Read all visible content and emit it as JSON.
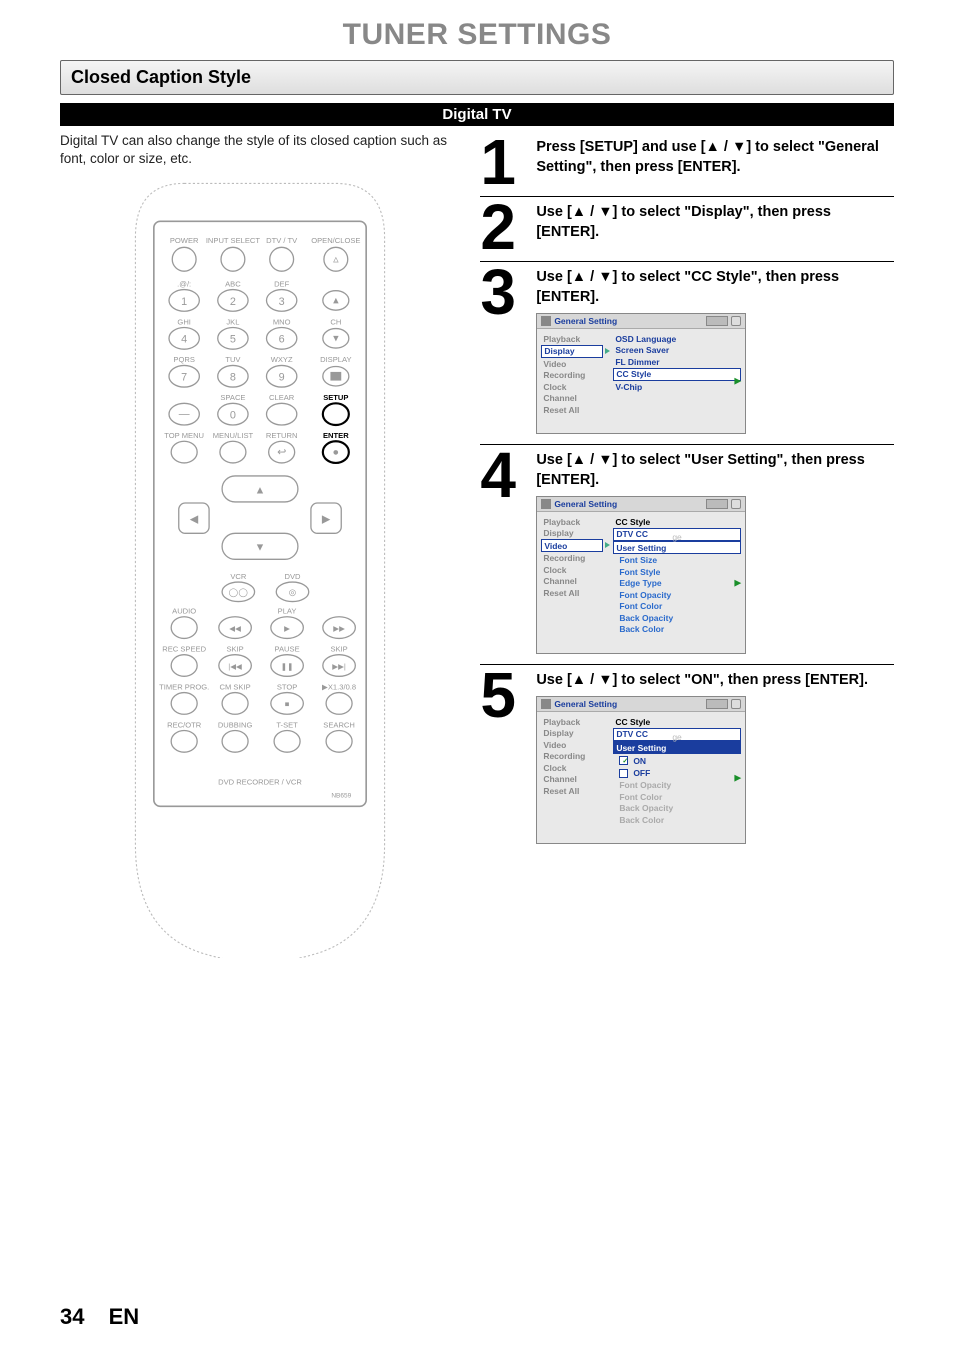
{
  "page_title": "TUNER SETTINGS",
  "section_title": "Closed Caption Style",
  "subheader_bar": "Digital TV",
  "intro_text": "Digital TV can also change the style of its closed caption such as font, color or size, etc.",
  "remote": {
    "labels": {
      "power": "POWER",
      "input_sel": "INPUT SELECT",
      "dtvtv": "DTV / TV",
      "open_close": "OPEN/CLOSE",
      "sym": ".@/:",
      "abc": "ABC",
      "def": "DEF",
      "ghi": "GHI",
      "jkl": "JKL",
      "mno": "MNO",
      "ch": "CH",
      "pqrs": "PQRS",
      "tuv": "TUV",
      "wxyz": "WXYZ",
      "display": "DISPLAY",
      "space": "SPACE",
      "clear": "CLEAR",
      "setup": "SETUP",
      "top_menu": "TOP MENU",
      "menu_list": "MENU/LIST",
      "return": "RETURN",
      "enter": "ENTER",
      "vcr": "VCR",
      "dvd": "DVD",
      "audio": "AUDIO",
      "play": "PLAY",
      "rec_speed": "REC SPEED",
      "skip1": "SKIP",
      "pause": "PAUSE",
      "skip2": "SKIP",
      "timer_prog": "TIMER PROG.",
      "cm_skip": "CM SKIP",
      "stop": "STOP",
      "x13": "▶X1.3/0.8",
      "rec_otr": "REC/OTR",
      "dubbing": "DUBBING",
      "tset": "T-SET",
      "search": "SEARCH",
      "brand": "DVD RECORDER / VCR",
      "model": "NB659"
    },
    "nums": {
      "n1": "1",
      "n2": "2",
      "n3": "3",
      "n4": "4",
      "n5": "5",
      "n6": "6",
      "n7": "7",
      "n8": "8",
      "n9": "9",
      "n0": "0"
    }
  },
  "steps": [
    {
      "num": "1",
      "text": "Press [SETUP] and use [▲ / ▼] to select \"General Setting\", then press [ENTER]."
    },
    {
      "num": "2",
      "text": "Use [▲ / ▼] to select \"Display\", then press [ENTER]."
    },
    {
      "num": "3",
      "text": "Use [▲ / ▼] to select \"CC Style\", then press [ENTER]."
    },
    {
      "num": "4",
      "text": "Use [▲ / ▼] to select \"User Setting\", then press [ENTER]."
    },
    {
      "num": "5",
      "text": "Use [▲ / ▼] to select \"ON\", then press [ENTER]."
    }
  ],
  "osd": {
    "title": "General Setting",
    "left_items": [
      "Playback",
      "Display",
      "Video",
      "Recording",
      "Clock",
      "Channel",
      "Reset All"
    ],
    "step3_right": [
      "OSD Language",
      "Screen Saver",
      "FL Dimmer",
      "CC Style",
      "V-Chip"
    ],
    "step4_sub_title": "CC Style",
    "step4_right": [
      "DTV CC",
      "User Setting",
      "Font Size",
      "Font Style",
      "Edge Type",
      "Font Opacity",
      "Font Color",
      "Back Opacity",
      "Back Color"
    ],
    "step4_ghost": "ge",
    "step5_sub_title": "CC Style",
    "step5_right_top": [
      "DTV CC",
      "User Setting"
    ],
    "step5_checks": {
      "on": "ON",
      "off": "OFF"
    },
    "step5_dim": [
      "Font Opacity",
      "Font Color",
      "Back Opacity",
      "Back Color"
    ],
    "step5_ghost": "ge"
  },
  "footer": {
    "page": "34",
    "lang": "EN"
  }
}
